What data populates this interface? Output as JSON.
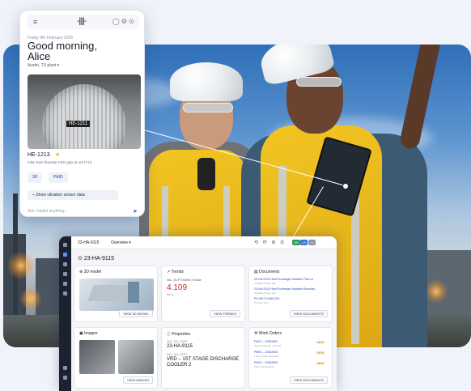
{
  "mobile": {
    "menu_icon": "hamburger-icon",
    "logo_glyph": "-||||-",
    "header_icons": "◯ ⚙ ⊙",
    "date": "Friday 9th February 2025",
    "greeting_line1": "Good morning,",
    "greeting_line2": "Alice",
    "location": "Austin, TX plant",
    "location_chevron": "▾",
    "image_tag": "HE-1211",
    "equipment_id": "HE-1213",
    "star": "★",
    "equipment_desc": "Inlet main flowrate H2O gals at 10-1712",
    "btn_3d": "3D",
    "btn_pid": "P&ID",
    "vibration_btn": "Show vibration sensor data",
    "ask_placeholder": "Ask Copilot anything...",
    "send_icon": "➤"
  },
  "desktop": {
    "breadcrumb": "23-HA-9115",
    "view_select": "Overview ▾",
    "toolbar_icons": "⟲ ⟳ ⊘ ⊙",
    "badges": [
      "GR",
      "LB",
      "+2"
    ],
    "page_title": "23-HA-9115",
    "model_card": {
      "title": "3D model",
      "button": "VIEW 3D MODEL"
    },
    "trends_card": {
      "title": "Trends",
      "series": "VAL_45-PT-92609.X.Value",
      "value": "4.109",
      "unit": "bar g",
      "button": "VIEW TRENDS"
    },
    "documents_card": {
      "title": "Documents",
      "items": [
        {
          "name": "23-HA-9115 Heat Exchanger Isolation Plan v1",
          "sub": "Updated 2 days ago"
        },
        {
          "name": "23-HA-9115 Heat Exchanger Isolation Boundar...",
          "sub": "Updated 5 days ago"
        },
        {
          "name": "PH-ME-P-0160-001",
          "sub": "Process flow"
        }
      ],
      "button": "VIEW DOCUMENTS"
    },
    "images_card": {
      "title": "Images",
      "button": "VIEW IMAGES"
    },
    "properties_card": {
      "title": "Properties",
      "fields": [
        {
          "label": "SAP_TAG_NAME",
          "value": "23-HA-9115"
        },
        {
          "label": "SAP_TAG_DESC",
          "value": "VRD – 1ST STAGE DISCHARGE COOLER 2"
        }
      ]
    },
    "workorders_card": {
      "title": "Work Orders",
      "items": [
        {
          "name": "PM01 – 22083051",
          "sub": "Heat exchanger cleaning",
          "tag": "NEW"
        },
        {
          "name": "PM03 – 22083903",
          "sub": "Tube bundle inspection",
          "tag": "NEW"
        },
        {
          "name": "PM03 – 22083902",
          "sub": "Valve maintenance",
          "tag": "NEW"
        }
      ],
      "button": "VIEW DOCUMENTS"
    }
  },
  "colors": {
    "accent": "#2747c9",
    "vest": "#f2c522",
    "sidebar": "#1c2230",
    "trend_value": "#d6261f"
  }
}
